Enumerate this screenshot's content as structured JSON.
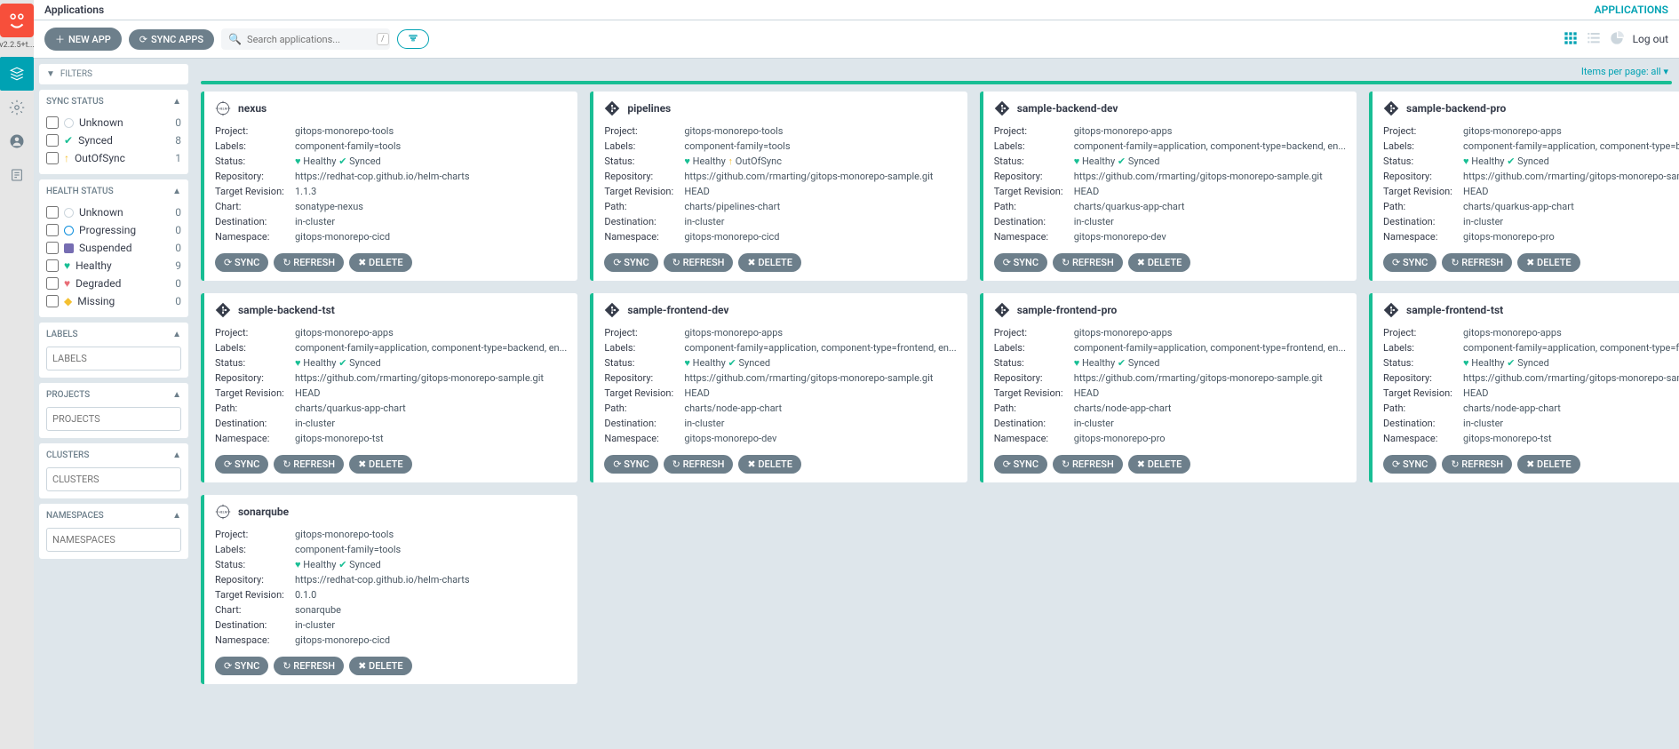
{
  "version": "v2.2.5+t...",
  "topbar": {
    "title": "Applications",
    "right_link": "APPLICATIONS",
    "logout": "Log out"
  },
  "toolbar": {
    "new_app": "NEW APP",
    "sync_apps": "SYNC APPS",
    "search_placeholder": "Search applications...",
    "items_per_page": "Items per page: all"
  },
  "filters": {
    "header": "FILTERS",
    "sync_status": {
      "title": "SYNC STATUS",
      "items": [
        {
          "label": "Unknown",
          "count": 0,
          "iconClass": "circle-empty"
        },
        {
          "label": "Synced",
          "count": 8,
          "iconClass": "circle-check",
          "glyph": "✔"
        },
        {
          "label": "OutOfSync",
          "count": 1,
          "iconClass": "circle-arrow",
          "glyph": "↑"
        }
      ]
    },
    "health_status": {
      "title": "HEALTH STATUS",
      "items": [
        {
          "label": "Unknown",
          "count": 0,
          "iconClass": "circle-empty"
        },
        {
          "label": "Progressing",
          "count": 0,
          "iconClass": "circle-blue"
        },
        {
          "label": "Suspended",
          "count": 0,
          "iconClass": "circle-pause"
        },
        {
          "label": "Healthy",
          "count": 9,
          "iconClass": "heart",
          "glyph": "♥"
        },
        {
          "label": "Degraded",
          "count": 0,
          "iconClass": "deg",
          "glyph": "♥"
        },
        {
          "label": "Missing",
          "count": 0,
          "iconClass": "ghost",
          "glyph": "◆"
        }
      ]
    },
    "labels": {
      "title": "LABELS",
      "placeholder": "LABELS"
    },
    "projects": {
      "title": "PROJECTS",
      "placeholder": "PROJECTS"
    },
    "clusters": {
      "title": "CLUSTERS",
      "placeholder": "CLUSTERS"
    },
    "namespaces": {
      "title": "NAMESPACES",
      "placeholder": "NAMESPACES"
    }
  },
  "buttons": {
    "sync": "SYNC",
    "refresh": "REFRESH",
    "delete": "DELETE"
  },
  "field_labels": {
    "project": "Project:",
    "labels": "Labels:",
    "status": "Status:",
    "repository": "Repository:",
    "target_revision": "Target Revision:",
    "chart": "Chart:",
    "path": "Path:",
    "destination": "Destination:",
    "namespace": "Namespace:"
  },
  "apps": [
    {
      "name": "nexus",
      "project": "gitops-monorepo-tools",
      "labels": "component-family=tools",
      "health": "Healthy",
      "sync": "Synced",
      "syncClass": "circle-check",
      "repository": "https://redhat-cop.github.io/helm-charts",
      "target_revision": "1.1.3",
      "chart": "sonatype-nexus",
      "path": null,
      "destination": "in-cluster",
      "namespace": "gitops-monorepo-cicd",
      "iconType": "helm"
    },
    {
      "name": "pipelines",
      "project": "gitops-monorepo-tools",
      "labels": "component-family=tools",
      "health": "Healthy",
      "sync": "OutOfSync",
      "syncClass": "circle-arrow",
      "repository": "https://github.com/rmarting/gitops-monorepo-sample.git",
      "target_revision": "HEAD",
      "chart": null,
      "path": "charts/pipelines-chart",
      "destination": "in-cluster",
      "namespace": "gitops-monorepo-cicd",
      "iconType": "git"
    },
    {
      "name": "sample-backend-dev",
      "project": "gitops-monorepo-apps",
      "labels": "component-family=application, component-type=backend, en...",
      "health": "Healthy",
      "sync": "Synced",
      "syncClass": "circle-check",
      "repository": "https://github.com/rmarting/gitops-monorepo-sample.git",
      "target_revision": "HEAD",
      "chart": null,
      "path": "charts/quarkus-app-chart",
      "destination": "in-cluster",
      "namespace": "gitops-monorepo-dev",
      "iconType": "git"
    },
    {
      "name": "sample-backend-pro",
      "project": "gitops-monorepo-apps",
      "labels": "component-family=application, component-type=backend, en...",
      "health": "Healthy",
      "sync": "Synced",
      "syncClass": "circle-check",
      "repository": "https://github.com/rmarting/gitops-monorepo-sample.git",
      "target_revision": "HEAD",
      "chart": null,
      "path": "charts/quarkus-app-chart",
      "destination": "in-cluster",
      "namespace": "gitops-monorepo-pro",
      "iconType": "git"
    },
    {
      "name": "sample-backend-tst",
      "project": "gitops-monorepo-apps",
      "labels": "component-family=application, component-type=backend, en...",
      "health": "Healthy",
      "sync": "Synced",
      "syncClass": "circle-check",
      "repository": "https://github.com/rmarting/gitops-monorepo-sample.git",
      "target_revision": "HEAD",
      "chart": null,
      "path": "charts/quarkus-app-chart",
      "destination": "in-cluster",
      "namespace": "gitops-monorepo-tst",
      "iconType": "git"
    },
    {
      "name": "sample-frontend-dev",
      "project": "gitops-monorepo-apps",
      "labels": "component-family=application, component-type=frontend, en...",
      "health": "Healthy",
      "sync": "Synced",
      "syncClass": "circle-check",
      "repository": "https://github.com/rmarting/gitops-monorepo-sample.git",
      "target_revision": "HEAD",
      "chart": null,
      "path": "charts/node-app-chart",
      "destination": "in-cluster",
      "namespace": "gitops-monorepo-dev",
      "iconType": "git"
    },
    {
      "name": "sample-frontend-pro",
      "project": "gitops-monorepo-apps",
      "labels": "component-family=application, component-type=frontend, en...",
      "health": "Healthy",
      "sync": "Synced",
      "syncClass": "circle-check",
      "repository": "https://github.com/rmarting/gitops-monorepo-sample.git",
      "target_revision": "HEAD",
      "chart": null,
      "path": "charts/node-app-chart",
      "destination": "in-cluster",
      "namespace": "gitops-monorepo-pro",
      "iconType": "git"
    },
    {
      "name": "sample-frontend-tst",
      "project": "gitops-monorepo-apps",
      "labels": "component-family=application, component-type=frontend, en...",
      "health": "Healthy",
      "sync": "Synced",
      "syncClass": "circle-check",
      "repository": "https://github.com/rmarting/gitops-monorepo-sample.git",
      "target_revision": "HEAD",
      "chart": null,
      "path": "charts/node-app-chart",
      "destination": "in-cluster",
      "namespace": "gitops-monorepo-tst",
      "iconType": "git"
    },
    {
      "name": "sonarqube",
      "project": "gitops-monorepo-tools",
      "labels": "component-family=tools",
      "health": "Healthy",
      "sync": "Synced",
      "syncClass": "circle-check",
      "repository": "https://redhat-cop.github.io/helm-charts",
      "target_revision": "0.1.0",
      "chart": "sonarqube",
      "path": null,
      "destination": "in-cluster",
      "namespace": "gitops-monorepo-cicd",
      "iconType": "helm"
    }
  ]
}
